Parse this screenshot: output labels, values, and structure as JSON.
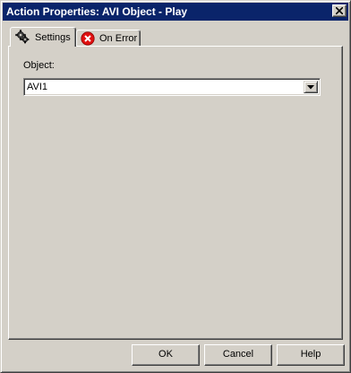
{
  "window": {
    "title": "Action Properties: AVI Object - Play"
  },
  "tabs": [
    {
      "label": "Settings",
      "icon": "gear-icon",
      "selected": true
    },
    {
      "label": "On Error",
      "icon": "error-icon",
      "selected": false
    }
  ],
  "settings": {
    "object_label": "Object:",
    "object_value": "AVI1"
  },
  "buttons": {
    "ok": "OK",
    "cancel": "Cancel",
    "help": "Help"
  },
  "colors": {
    "titlebar": "#0a246a",
    "face": "#d4d0c8",
    "error_red": "#e01010"
  }
}
